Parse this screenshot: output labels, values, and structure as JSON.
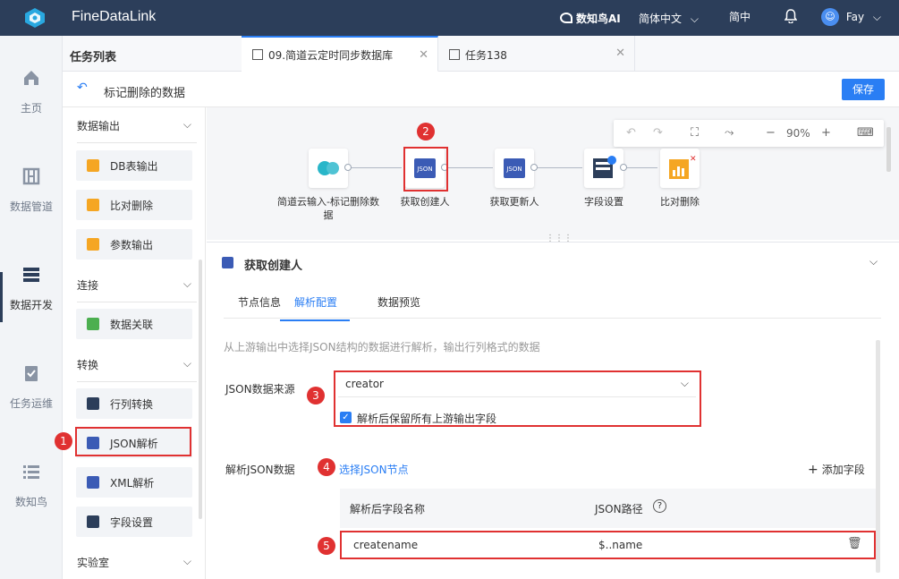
{
  "app": {
    "name": "FineDataLink",
    "ai_label": "数知鸟AI",
    "language": "简体中文",
    "lang_short": "简中",
    "user": "Fay"
  },
  "rail": {
    "items": [
      {
        "label": "主页",
        "icon": "home-icon"
      },
      {
        "label": "数据管道",
        "icon": "pipeline-icon"
      },
      {
        "label": "数据开发",
        "icon": "dev-icon"
      },
      {
        "label": "任务运维",
        "icon": "clipboard-icon"
      },
      {
        "label": "数知鸟",
        "icon": "list-icon"
      }
    ]
  },
  "tasks": {
    "header": "任务列表"
  },
  "tabs": [
    {
      "label": "09.简道云定时同步数据库"
    },
    {
      "label": "任务138"
    }
  ],
  "subheader": {
    "back_title": "标记删除的数据",
    "save": "保存"
  },
  "palette": {
    "categories": [
      "数据输出",
      "连接",
      "转换",
      "实验室"
    ],
    "items": [
      "DB表输出",
      "比对删除",
      "参数输出",
      "数据关联",
      "行列转换",
      "JSON解析",
      "XML解析",
      "字段设置"
    ]
  },
  "canvas": {
    "zoom": "90%",
    "nodes": [
      {
        "label": "简道云输入-标记删除数据"
      },
      {
        "label": "获取创建人"
      },
      {
        "label": "获取更新人"
      },
      {
        "label": "字段设置"
      },
      {
        "label": "比对删除"
      }
    ]
  },
  "panel": {
    "title": "获取创建人",
    "tabs": [
      "节点信息",
      "解析配置",
      "数据预览"
    ],
    "hint": "从上游输出中选择JSON结构的数据进行解析，输出行列格式的数据",
    "source_label": "JSON数据来源",
    "source_value": "creator",
    "keep_fields": "解析后保留所有上游输出字段",
    "parse_label": "解析JSON数据",
    "choose_node": "选择JSON节点",
    "add_field": "添加字段",
    "col_name": "解析后字段名称",
    "col_path": "JSON路径",
    "row_name": "createname",
    "row_path": "$..name"
  },
  "badges": [
    "1",
    "2",
    "3",
    "4",
    "5"
  ],
  "colors": {
    "topbar": "#2c3e5a",
    "accent": "#2a7ef4",
    "marker": "#e03131"
  }
}
